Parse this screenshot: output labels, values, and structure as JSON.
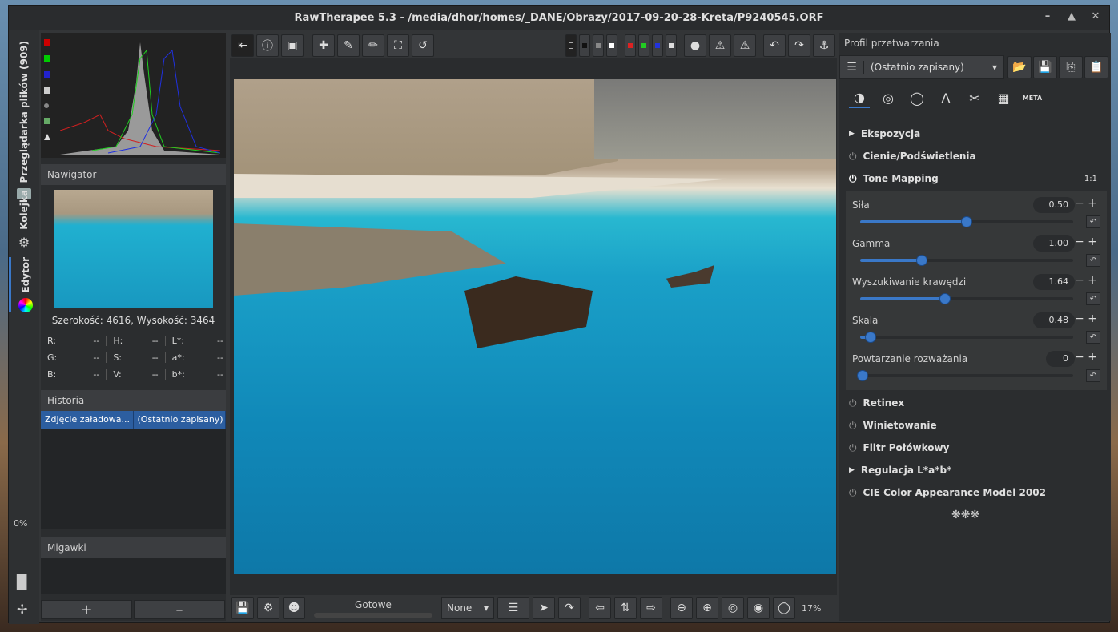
{
  "window": {
    "title": "RawTherapee 5.3 - /media/dhor/homes/_DANE/Obrazy/2017-09-20-28-Kreta/P9240545.ORF"
  },
  "vertical_tabs": {
    "browser": "Przeglądarka plików (909)",
    "queue": "Kolejka",
    "editor": "Edytor"
  },
  "left": {
    "navigator_title": "Nawigator",
    "dimensions": "Szerokość: 4616, Wysokość: 3464",
    "readouts": [
      {
        "label": "R:",
        "value": "--"
      },
      {
        "label": "H:",
        "value": "--"
      },
      {
        "label": "L*:",
        "value": "--"
      },
      {
        "label": "G:",
        "value": "--"
      },
      {
        "label": "S:",
        "value": "--"
      },
      {
        "label": "a*:",
        "value": "--"
      },
      {
        "label": "B:",
        "value": "--"
      },
      {
        "label": "V:",
        "value": "--"
      },
      {
        "label": "b*:",
        "value": "--"
      }
    ],
    "history_title": "Historia",
    "history_row": {
      "action": "Zdjęcie załadowa...",
      "value": "(Ostatnio zapisany)"
    },
    "snapshots_title": "Migawki",
    "progress": "0%"
  },
  "bottom": {
    "status": "Gotowe",
    "select": "None",
    "zoom": "17%"
  },
  "right": {
    "profile_title": "Profil przetwarzania",
    "profile_value": "(Ostatnio zapisany)",
    "meta_tab": "META",
    "sections": [
      {
        "label": "Ekspozycja",
        "type": "expander"
      },
      {
        "label": "Cienie/Podświetlenia",
        "type": "toggle"
      },
      {
        "label": "Tone Mapping",
        "type": "toggle",
        "badge": "1:1"
      },
      {
        "label": "Retinex",
        "type": "toggle"
      },
      {
        "label": "Winietowanie",
        "type": "toggle"
      },
      {
        "label": "Filtr Połówkowy",
        "type": "toggle"
      },
      {
        "label": "Regulacja L*a*b*",
        "type": "expander"
      },
      {
        "label": "CIE Color Appearance Model 2002",
        "type": "toggle"
      }
    ],
    "sliders": [
      {
        "label": "Siła",
        "value": "0.50",
        "pct": 50
      },
      {
        "label": "Gamma",
        "value": "1.00",
        "pct": 29
      },
      {
        "label": "Wyszukiwanie krawędzi",
        "value": "1.64",
        "pct": 40
      },
      {
        "label": "Skala",
        "value": "0.48",
        "pct": 5
      },
      {
        "label": "Powtarzanie rozważania",
        "value": "0",
        "pct": 1
      }
    ]
  },
  "colors": {
    "accent": "#3a78c8",
    "highlight_row": "#2c5ea0"
  }
}
